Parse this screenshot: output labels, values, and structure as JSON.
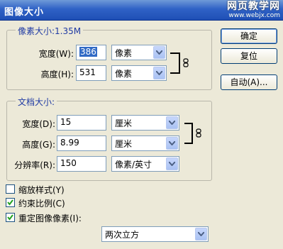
{
  "window": {
    "title": "图像大小",
    "watermark": "网页教学网",
    "watermark_url": "www.webjx.com"
  },
  "pixel_dims": {
    "legend": "像素大小:1.35M",
    "width_label": "宽度(W):",
    "width_value": "386",
    "width_unit": "像素",
    "height_label": "高度(H):",
    "height_value": "531",
    "height_unit": "像素"
  },
  "doc_size": {
    "legend": "文档大小:",
    "width_label": "宽度(D):",
    "width_value": "15",
    "width_unit": "厘米",
    "height_label": "高度(G):",
    "height_value": "8.99",
    "height_unit": "厘米",
    "res_label": "分辨率(R):",
    "res_value": "150",
    "res_unit": "像素/英寸"
  },
  "buttons": {
    "ok": "确定",
    "reset": "复位",
    "auto": "自动(A)..."
  },
  "options": {
    "scale_styles": "缩放样式(Y)",
    "constrain": "约束比例(C)",
    "resample": "重定图像像素(I):",
    "scale_checked": false,
    "constrain_checked": true,
    "resample_checked": true
  },
  "resample_method": "两次立方",
  "colors": {
    "title_bg": "#2f62c6",
    "accent": "#1f3aa3"
  },
  "icons": [
    "link-chain-icon",
    "dropdown-arrow-icon",
    "checkmark-icon"
  ]
}
